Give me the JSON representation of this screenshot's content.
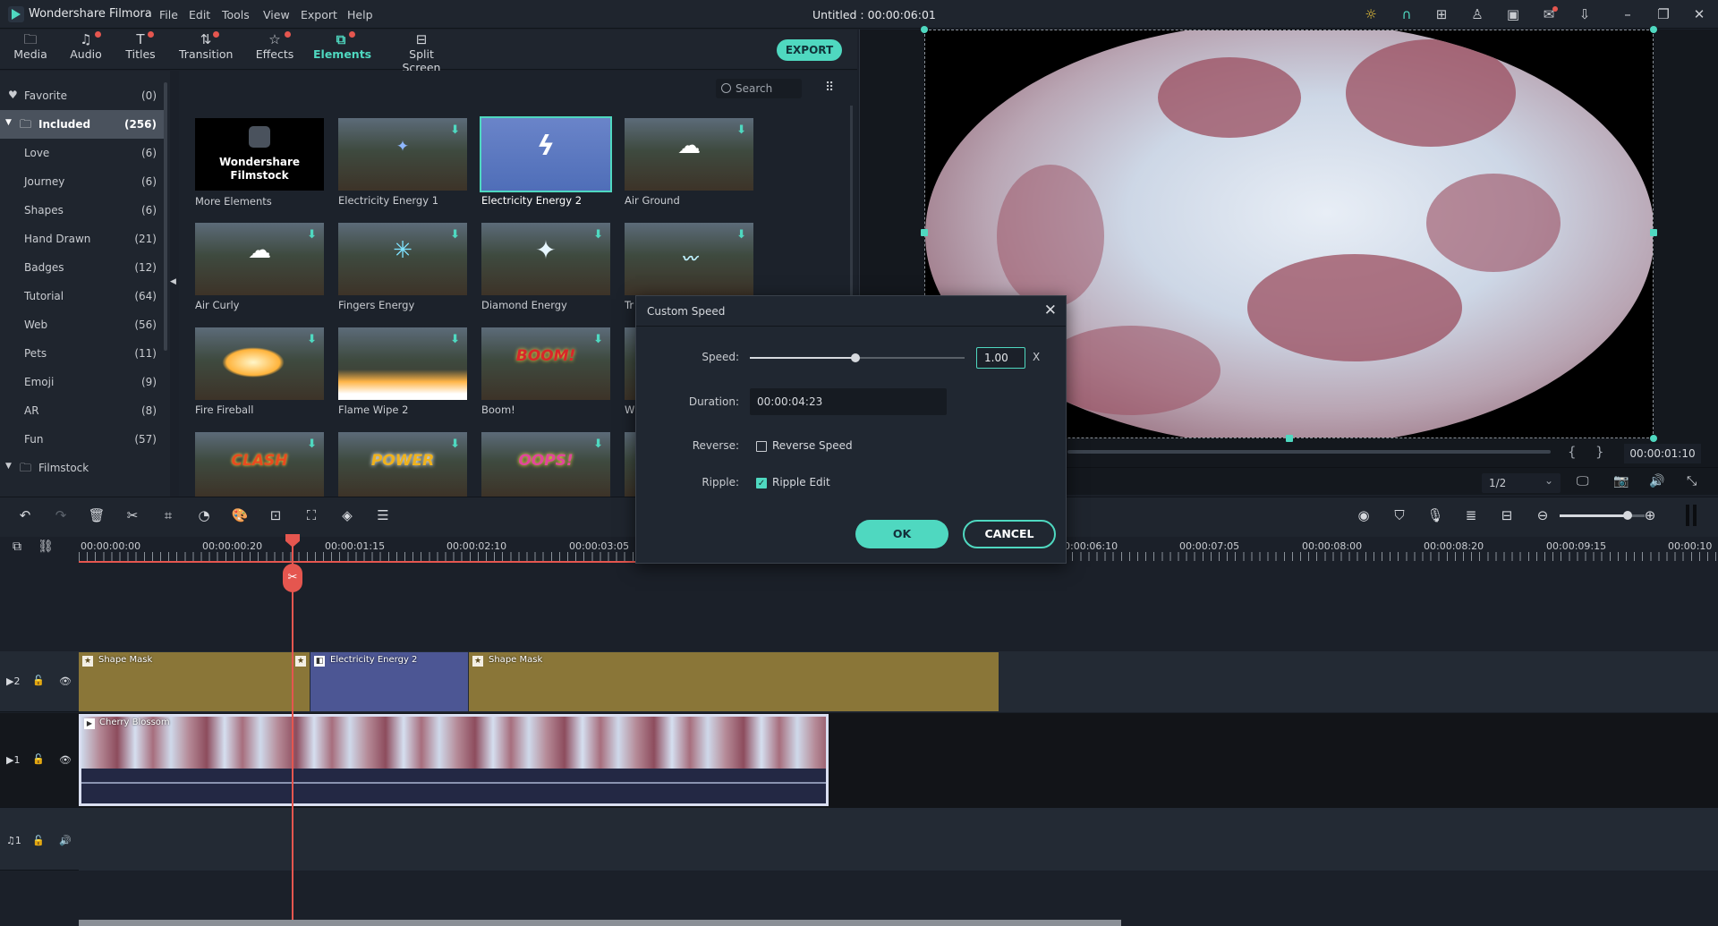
{
  "app": {
    "name": "Wondershare Filmora",
    "doc_title": "Untitled : 00:00:06:01",
    "menu": [
      "File",
      "Edit",
      "Tools",
      "View",
      "Export",
      "Help"
    ],
    "title_icons": [
      "bulb-icon",
      "headset-icon",
      "gift-icon",
      "user-icon",
      "save-icon",
      "mail-icon",
      "download-icon",
      "minimize-icon",
      "restore-icon",
      "close-icon"
    ]
  },
  "tabs": [
    {
      "label": "Media",
      "icon": "folder-icon",
      "badge": false,
      "active": false
    },
    {
      "label": "Audio",
      "icon": "music-icon",
      "badge": true,
      "active": false
    },
    {
      "label": "Titles",
      "icon": "text-icon",
      "badge": true,
      "active": false
    },
    {
      "label": "Transition",
      "icon": "transition-icon",
      "badge": true,
      "active": false
    },
    {
      "label": "Effects",
      "icon": "effects-icon",
      "badge": true,
      "active": false
    },
    {
      "label": "Elements",
      "icon": "elements-icon",
      "badge": true,
      "active": true
    },
    {
      "label": "Split Screen",
      "icon": "split-screen-icon",
      "badge": false,
      "active": false
    }
  ],
  "export_label": "EXPORT",
  "sidebar": {
    "favorite": {
      "label": "Favorite",
      "count": "(0)"
    },
    "included": {
      "label": "Included",
      "count": "(256)"
    },
    "items": [
      {
        "label": "Love",
        "count": "(6)"
      },
      {
        "label": "Journey",
        "count": "(6)"
      },
      {
        "label": "Shapes",
        "count": "(6)"
      },
      {
        "label": "Hand Drawn",
        "count": "(21)"
      },
      {
        "label": "Badges",
        "count": "(12)"
      },
      {
        "label": "Tutorial",
        "count": "(64)"
      },
      {
        "label": "Web",
        "count": "(56)"
      },
      {
        "label": "Pets",
        "count": "(11)"
      },
      {
        "label": "Emoji",
        "count": "(9)"
      },
      {
        "label": "AR",
        "count": "(8)"
      },
      {
        "label": "Fun",
        "count": "(57)"
      }
    ],
    "filmstock": {
      "label": "Filmstock"
    }
  },
  "search": {
    "placeholder": "Search"
  },
  "elements": [
    {
      "label": "More Elements",
      "banner": "Wondershare Filmstock"
    },
    {
      "label": "Electricity Energy 1",
      "download": true
    },
    {
      "label": "Electricity Energy 2",
      "selected": true
    },
    {
      "label": "Air Ground",
      "download": true
    },
    {
      "label": "Air Curly",
      "download": true
    },
    {
      "label": "Fingers Energy",
      "download": true
    },
    {
      "label": "Diamond Energy",
      "download": true
    },
    {
      "label": "Tr",
      "download": true
    },
    {
      "label": "Fire Fireball",
      "download": true
    },
    {
      "label": "Flame Wipe 2",
      "download": true
    },
    {
      "label": "Boom!",
      "download": true,
      "art": "BOOM!"
    },
    {
      "label": "W",
      "download": true
    },
    {
      "label": "",
      "download": true,
      "art": "CLASH"
    },
    {
      "label": "",
      "download": true,
      "art": "POWER"
    },
    {
      "label": "",
      "download": true,
      "art": "OOPS!"
    }
  ],
  "preview": {
    "timecode": "00:00:01:10",
    "quality": "1/2",
    "in_mark": "{",
    "out_mark": "}"
  },
  "timeline": {
    "ruler": [
      "00:00:00:00",
      "00:00:00:20",
      "00:00:01:15",
      "00:00:02:10",
      "00:00:03:05",
      "00:00:06:10",
      "00:00:07:05",
      "00:00:08:00",
      "00:00:08:20",
      "00:00:09:15",
      "00:00:10"
    ],
    "tracks": [
      {
        "id": "V2",
        "num": "2"
      },
      {
        "id": "V1",
        "num": "1"
      },
      {
        "id": "A1",
        "num": "1"
      }
    ],
    "clips": {
      "v2": [
        "Shape Mask",
        "Electricity Energy 2",
        "Shape Mask"
      ],
      "v1": "Cherry Blossom"
    },
    "zoom_level": 0.8
  },
  "dialog": {
    "title": "Custom Speed",
    "speed_label": "Speed:",
    "speed_value": "1.00",
    "speed_fraction": 0.49,
    "speed_unit": "X",
    "duration_label": "Duration:",
    "duration_value": "00:00:04:23",
    "reverse_label": "Reverse:",
    "reverse_option": "Reverse Speed",
    "reverse_checked": false,
    "ripple_label": "Ripple:",
    "ripple_option": "Ripple Edit",
    "ripple_checked": true,
    "ok": "OK",
    "cancel": "CANCEL"
  }
}
